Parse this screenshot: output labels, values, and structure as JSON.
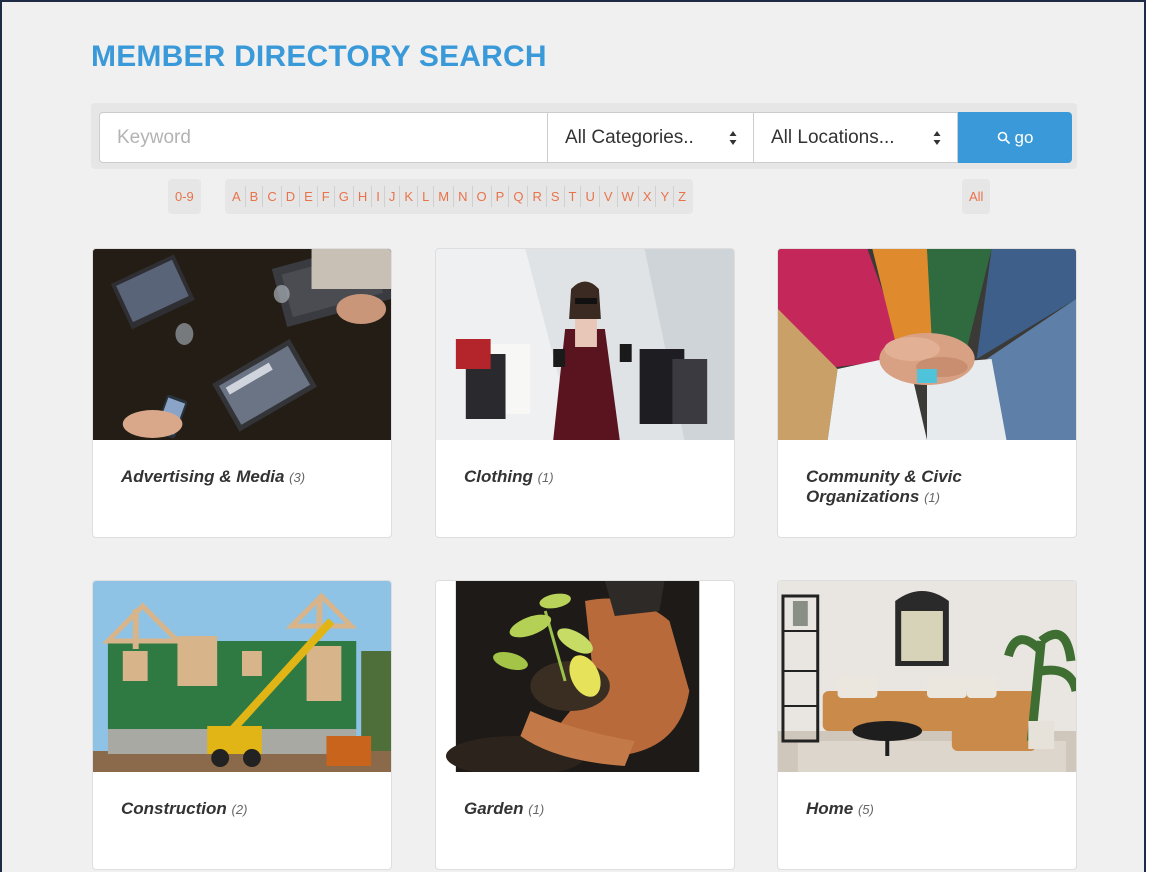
{
  "page": {
    "title": "MEMBER DIRECTORY SEARCH",
    "accent_color": "#3a9ad9",
    "letter_color": "#e8734a"
  },
  "search": {
    "keyword_placeholder": "Keyword",
    "category_selected": "All Categories..",
    "location_selected": "All Locations...",
    "go_label": "go",
    "go_icon": "search-icon",
    "select_icon": "sort-arrows-icon"
  },
  "alpha_filter": {
    "numeric": "0-9",
    "letters": [
      "A",
      "B",
      "C",
      "D",
      "E",
      "F",
      "G",
      "H",
      "I",
      "J",
      "K",
      "L",
      "M",
      "N",
      "O",
      "P",
      "Q",
      "R",
      "S",
      "T",
      "U",
      "V",
      "W",
      "X",
      "Y",
      "Z"
    ],
    "all": "All"
  },
  "categories": [
    {
      "name": "Advertising & Media",
      "count": "(3)",
      "image": "office-laptops-photo"
    },
    {
      "name": "Clothing",
      "count": "(1)",
      "image": "shopping-woman-photo"
    },
    {
      "name": "Community & Civic Organizations",
      "count": "(1)",
      "image": "stacked-hands-photo"
    },
    {
      "name": "Construction",
      "count": "(2)",
      "image": "house-framing-photo"
    },
    {
      "name": "Garden",
      "count": "(1)",
      "image": "seedling-hands-photo"
    },
    {
      "name": "Home",
      "count": "(5)",
      "image": "living-room-photo"
    }
  ]
}
